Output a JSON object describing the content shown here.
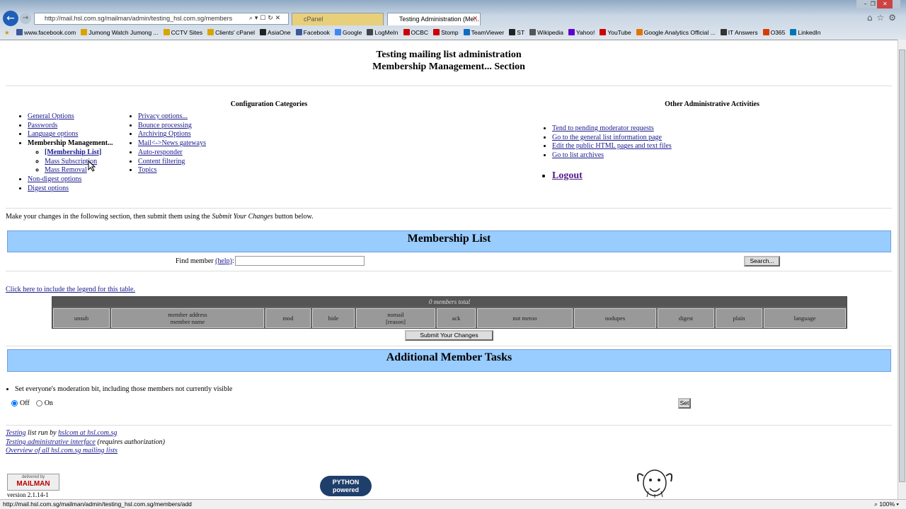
{
  "browser": {
    "url": "http://mail.hsl.com.sg/mailman/admin/testing_hsl.com.sg/members",
    "tab1_label": "cPanel",
    "tab2_label": "Testing Administration (Me...",
    "favorites": [
      "www.facebook.com",
      "Jumong  Watch Jumong ...",
      "CCTV Sites",
      "Clients' cPanel",
      "AsiaOne",
      "Facebook",
      "Google",
      "LogMeIn",
      "OCBC",
      "Stomp",
      "TeamViewer",
      "ST",
      "Wikipedia",
      "Yahoo!",
      "YouTube",
      "Google Analytics  Official ...",
      "IT Answers",
      "O365",
      "LinkedIn"
    ],
    "favorite_colors": [
      "#3b5998",
      "#d9a400",
      "#d9a400",
      "#d9a400",
      "#222",
      "#3b5998",
      "#4285f4",
      "#444",
      "#c00",
      "#c00",
      "#0e6cc4",
      "#222",
      "#555",
      "#6001d2",
      "#c00",
      "#e37400",
      "#333",
      "#d83b01",
      "#0077b5"
    ],
    "status_text": "http://mail.hsl.com.sg/mailman/admin/testing_hsl.com.sg/members/add",
    "zoom": "100%"
  },
  "page": {
    "title_line1": "Testing mailing list administration",
    "title_line2": "Membership Management... Section",
    "config_heading": "Configuration Categories",
    "other_heading": "Other Administrative Activities",
    "config_col1": {
      "general": "General Options",
      "passwords": "Passwords",
      "language": "Language options",
      "membership": "Membership Management...",
      "membership_list": "[Membership List]",
      "mass_subscription": "Mass Subscription",
      "mass_removal": "Mass Removal",
      "non_digest": "Non-digest options",
      "digest": "Digest options"
    },
    "config_col2": [
      "Privacy options...",
      "Bounce processing",
      "Archiving Options",
      "Mail<->News gateways",
      "Auto-responder",
      "Content filtering",
      "Topics"
    ],
    "other_links": [
      "Tend to pending moderator requests",
      "Go to the general list information page",
      "Edit the public HTML pages and text files",
      "Go to list archives"
    ],
    "logout": "Logout",
    "instructions_pre": "Make your changes in the following section, then submit them using the ",
    "instructions_em": "Submit Your Changes",
    "instructions_post": " button below.",
    "membership_band": "Membership List",
    "find_member_label": "Find member",
    "help_link": "(help)",
    "find_member_value": "",
    "search_button": "Search...",
    "legend_link": "Click here to include the legend for this table.",
    "table_header": "0 members total",
    "columns": [
      {
        "l1": "unsub",
        "l2": ""
      },
      {
        "l1": "member address",
        "l2": "member name"
      },
      {
        "l1": "mod",
        "l2": ""
      },
      {
        "l1": "hide",
        "l2": ""
      },
      {
        "l1": "nomail",
        "l2": "[reason]"
      },
      {
        "l1": "ack",
        "l2": ""
      },
      {
        "l1": "not metoo",
        "l2": ""
      },
      {
        "l1": "nodupes",
        "l2": ""
      },
      {
        "l1": "digest",
        "l2": ""
      },
      {
        "l1": "plain",
        "l2": ""
      },
      {
        "l1": "language",
        "l2": ""
      }
    ],
    "submit_button": "Submit Your Changes",
    "additional_band": "Additional Member Tasks",
    "moderation_text": "Set everyone's moderation bit, including those members not currently visible",
    "radio_off": "Off",
    "radio_on": "On",
    "set_button": "Set",
    "footer_list": "Testing",
    "footer_runby": " list run by ",
    "footer_owner": "hslcom at hsl.com.sg",
    "footer_admin": "Testing administrative interface",
    "footer_admin_note": " (requires authorization)",
    "footer_overview": "Overview of all hsl.com.sg mailing lists",
    "mailman_logo": "MAILMAN",
    "mailman_tagline": "delivered by",
    "python_logo_l1": "PYTHON",
    "python_logo_l2": "powered",
    "version": "version 2.1.14-1"
  }
}
